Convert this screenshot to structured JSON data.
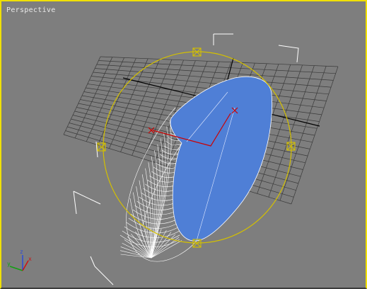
{
  "viewport": {
    "label": "Perspective",
    "active_border_color": "#f0e000",
    "background_color": "#7e7e7e",
    "grid_color": "#3a3a3a",
    "axis_color": "#000000",
    "selection_color": "#ffffff",
    "gizmo_color": "#d4c000",
    "surface_color": "#4f7fd6",
    "wire_color": "#ffffff",
    "pivot_axis_color": "#cc0000"
  },
  "axis_tripod": {
    "x_label": "x",
    "y_label": "y",
    "z_label": "z"
  }
}
